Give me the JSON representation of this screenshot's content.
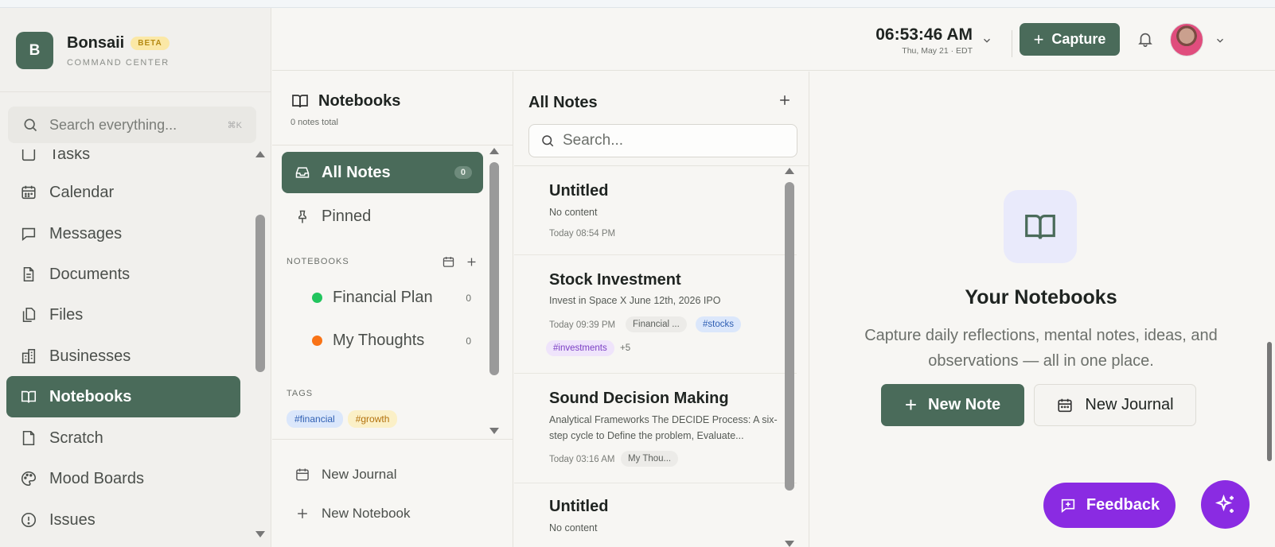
{
  "brand": {
    "logo_letter": "B",
    "name": "Bonsaii",
    "badge": "BETA",
    "subtitle": "COMMAND CENTER"
  },
  "search": {
    "placeholder": "Search everything...",
    "shortcut": "⌘K"
  },
  "sidebar": {
    "items": [
      {
        "label": "Tasks",
        "icon": "check-square-icon"
      },
      {
        "label": "Calendar",
        "icon": "calendar-icon"
      },
      {
        "label": "Messages",
        "icon": "message-icon"
      },
      {
        "label": "Documents",
        "icon": "document-icon"
      },
      {
        "label": "Files",
        "icon": "files-icon"
      },
      {
        "label": "Businesses",
        "icon": "building-icon"
      },
      {
        "label": "Notebooks",
        "icon": "book-open-icon",
        "active": true
      },
      {
        "label": "Scratch",
        "icon": "note-icon"
      },
      {
        "label": "Mood Boards",
        "icon": "palette-icon"
      },
      {
        "label": "Issues",
        "icon": "alert-circle-icon"
      }
    ]
  },
  "header": {
    "time": "06:53:46 AM",
    "date": "Thu, May 21 · EDT",
    "capture_label": "Capture"
  },
  "notebooks_panel": {
    "title": "Notebooks",
    "count_text": "0 notes total",
    "all_notes_label": "All Notes",
    "all_notes_count": "0",
    "pinned_label": "Pinned",
    "notebooks_section": "NOTEBOOKS",
    "notebooks": [
      {
        "name": "Financial Plan",
        "count": "0",
        "color": "#22c55e"
      },
      {
        "name": "My Thoughts",
        "count": "0",
        "color": "#f97316"
      }
    ],
    "tags_section": "TAGS",
    "tags": [
      {
        "label": "#financial",
        "bg": "#dbe7fb",
        "fg": "#2f5fb3"
      },
      {
        "label": "#growth",
        "bg": "#fbf0c7",
        "fg": "#b3720e"
      }
    ],
    "new_journal_label": "New Journal",
    "new_notebook_label": "New Notebook"
  },
  "notes_panel": {
    "title": "All Notes",
    "search_placeholder": "Search...",
    "notes": [
      {
        "title": "Untitled",
        "preview": "No content",
        "date": "Today 08:54 PM"
      },
      {
        "title": "Stock Investment",
        "preview": "Invest in Space X June 12th, 2026 IPO",
        "date": "Today 09:39 PM",
        "chips": [
          "Financial ...",
          "#stocks",
          "#investments",
          "+5"
        ]
      },
      {
        "title": "Sound Decision Making",
        "preview": "Analytical Frameworks The DECIDE Process: A six-step cycle to Define the problem, Evaluate...",
        "date": "Today 03:16 AM",
        "chips": [
          "My Thou..."
        ]
      },
      {
        "title": "Untitled",
        "preview": "No content"
      }
    ]
  },
  "empty_state": {
    "title": "Your Notebooks",
    "description": "Capture daily reflections, mental notes, ideas, and observations — all in one place.",
    "new_note_label": "New Note",
    "new_journal_label": "New Journal"
  },
  "feedback_label": "Feedback",
  "colors": {
    "accent": "#4a6b5a",
    "feedback": "#8a2be2",
    "beta_bg": "#fbe8a6"
  }
}
